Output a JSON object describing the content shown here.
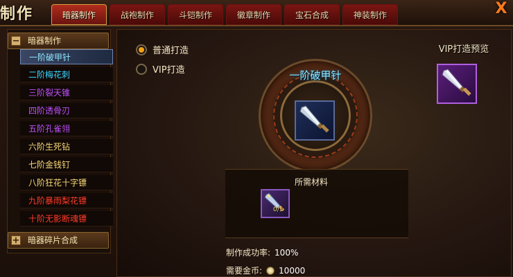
{
  "window": {
    "title": "制作",
    "close_label": "X"
  },
  "tabs": [
    {
      "label": "暗器制作",
      "active": true
    },
    {
      "label": "战袍制作",
      "active": false
    },
    {
      "label": "斗铠制作",
      "active": false
    },
    {
      "label": "徽章制作",
      "active": false
    },
    {
      "label": "宝石合成",
      "active": false
    },
    {
      "label": "神装制作",
      "active": false
    }
  ],
  "sidebar": {
    "category_open": {
      "label": "暗器制作",
      "toggle": "−"
    },
    "items": [
      {
        "label": "一阶破甲针",
        "color": "#8ee6ff",
        "selected": true
      },
      {
        "label": "二阶梅花刺",
        "color": "#3ad6ff",
        "selected": false
      },
      {
        "label": "三阶裂天锥",
        "color": "#c050ff",
        "selected": false
      },
      {
        "label": "四阶透骨刃",
        "color": "#c050ff",
        "selected": false
      },
      {
        "label": "五阶孔雀翎",
        "color": "#c050ff",
        "selected": false
      },
      {
        "label": "六阶生死钻",
        "color": "#f6d878",
        "selected": false
      },
      {
        "label": "七阶金钱钉",
        "color": "#f6d878",
        "selected": false
      },
      {
        "label": "八阶狂花十字镖",
        "color": "#f6d878",
        "selected": false
      },
      {
        "label": "九阶暴雨梨花镖",
        "color": "#ff3a2a",
        "selected": false
      },
      {
        "label": "十阶无影断魂镖",
        "color": "#ff3a2a",
        "selected": false
      }
    ],
    "category_closed": {
      "label": "暗器碎片合成",
      "toggle": "+"
    }
  },
  "forge": {
    "mode_normal": "普通打造",
    "mode_vip": "VIP打造",
    "selected_mode": "normal",
    "item_name": "一阶破甲针",
    "vip_preview_label": "VIP打造预览",
    "materials_label": "所需材料",
    "material_count": "0/1",
    "success_rate_label": "制作成功率:",
    "success_rate_value": "100%",
    "gold_label": "需要金币:",
    "gold_value": "10000"
  },
  "colors": {
    "accent": "#f6a016",
    "tab_active": "#b02c1c",
    "item_title": "#8ee6ff"
  }
}
